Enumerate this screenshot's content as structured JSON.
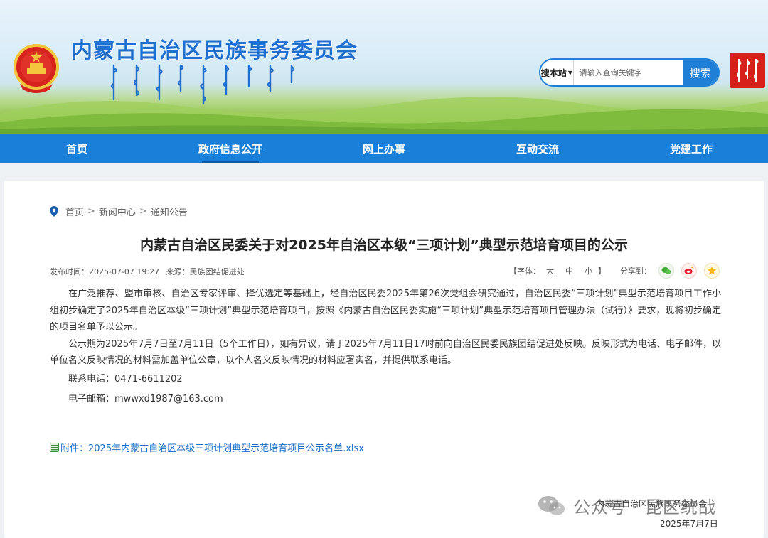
{
  "header": {
    "site_title": "内蒙古自治区民族事务委员会",
    "search": {
      "scope_label": "搜本站",
      "placeholder": "请输入查询关键字",
      "button_label": "搜索"
    }
  },
  "nav": {
    "items": [
      {
        "label": "首页"
      },
      {
        "label": "政府信息公开",
        "active": true
      },
      {
        "label": "网上办事"
      },
      {
        "label": "互动交流"
      },
      {
        "label": "党建工作"
      }
    ]
  },
  "breadcrumb": {
    "items": [
      "首页",
      "新闻中心",
      "通知公告"
    ],
    "separator": ">"
  },
  "article": {
    "title": "内蒙古自治区民委关于对2025年自治区本级“三项计划”典型示范培育项目的公示",
    "publish_time": "发布时间：2025-07-07 19:27",
    "source": "来源：民族团结促进处",
    "font_size_label": "【字体：",
    "font_sizes": [
      "大",
      "中",
      "小"
    ],
    "font_size_close": "】",
    "share_label": "分享到：",
    "paragraphs": [
      "在广泛推荐、盟市审核、自治区专家评审、择优选定等基础上，经自治区民委2025年第26次党组会研究通过，自治区民委“三项计划”典型示范培育项目工作小组初步确定了2025年自治区本级“三项计划”典型示范培育项目，按照《内蒙古自治区民委实施“三项计划”典型示范培育项目管理办法（试行）》要求，现将初步确定的项目名单予以公示。",
      "公示期为2025年7月7日至7月11日（5个工作日），如有异议，请于2025年7月11日17时前向自治区民委民族团结促进处反映。反映形式为电话、电子邮件，以单位名义反映情况的材料需加盖单位公章，以个人名义反映情况的材料应署实名，并提供联系电话。"
    ],
    "contact_phone": "联系电话：0471-6611202",
    "contact_email": "电子邮箱：mwwxd1987@163.com",
    "attachment": "附件：2025年内蒙古自治区本级三项计划典型示范培育项目公示名单.xlsx",
    "sign_org": "内蒙古自治区民族事务委员会",
    "sign_date": "2025年7月7日"
  },
  "watermark": {
    "text": "公众号 · 昆区统战"
  },
  "colors": {
    "brand_blue": "#1a7fd8",
    "title_blue": "#1f6fd0",
    "link_blue": "#1a6cc4",
    "seal_red": "#d8201b"
  },
  "icons": [
    "national-emblem-icon",
    "location-pin-icon",
    "wechat-icon",
    "weibo-icon",
    "qzone-icon",
    "excel-file-icon",
    "wechat-official-account-icon"
  ]
}
